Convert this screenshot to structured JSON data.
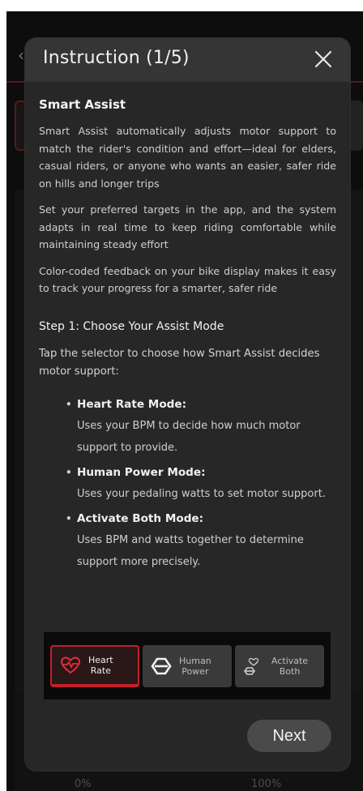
{
  "background": {
    "scale_min": "0%",
    "scale_max": "100%"
  },
  "modal": {
    "title": "Instruction (1/5)",
    "section_title": "Smart Assist",
    "paragraphs": [
      "Smart Assist automatically adjusts motor support to match the rider's condition and effort—ideal for elders, casual riders, or anyone who wants an easier, safer ride on hills and longer trips",
      "Set your preferred targets in the app, and the system adapts in real time to keep riding comfortable while maintaining steady effort",
      "Color-coded feedback on your bike display makes it easy to track your progress for a smarter, safer ride"
    ],
    "step_title": "Step 1: Choose Your Assist Mode",
    "step_desc": "Tap the selector to choose how Smart Assist decides motor support:",
    "modes": [
      {
        "name": "Heart Rate Mode:",
        "desc": "Uses your BPM to decide how much motor support to provide."
      },
      {
        "name": "Human Power Mode:",
        "desc": "Uses your pedaling watts to set motor support."
      },
      {
        "name": "Activate Both Mode:",
        "desc": "Uses BPM and watts together to determine support more precisely."
      }
    ],
    "selector": [
      {
        "label": "Heart\nRate",
        "icon": "heart-icon",
        "active": true
      },
      {
        "label": "Human\nPower",
        "icon": "power-icon",
        "active": false
      },
      {
        "label": "Activate\nBoth",
        "icon": "both-icon",
        "active": false
      }
    ],
    "next_label": "Next"
  },
  "colors": {
    "accent": "#c4202a",
    "modal_bg": "#272727",
    "header_bg": "#353535"
  }
}
